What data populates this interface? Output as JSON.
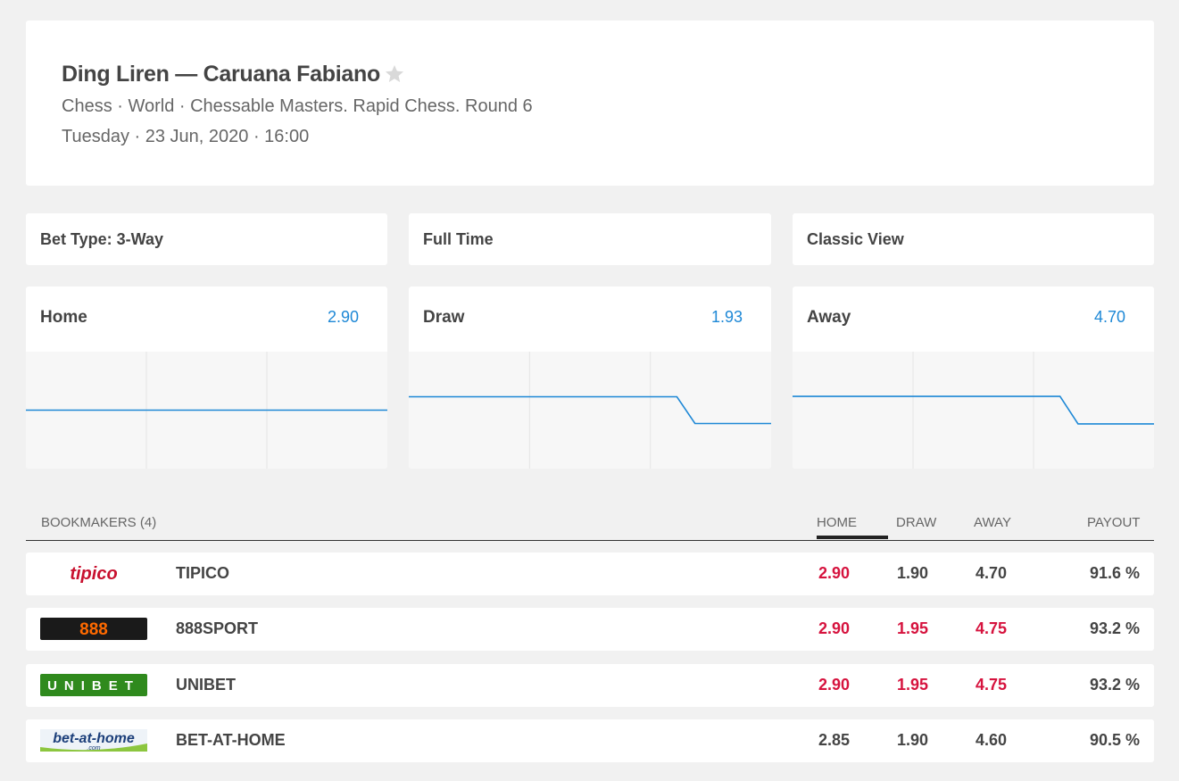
{
  "match": {
    "title": "Ding Liren — Caruana Fabiano",
    "subtitle": "Chess · World · Chessable Masters. Rapid Chess. Round 6",
    "datetime": "Tuesday · 23 Jun, 2020 · 16:00"
  },
  "filters": {
    "bet_type": "Bet Type: 3-Way",
    "period": "Full Time",
    "view": "Classic View"
  },
  "odds_summary": [
    {
      "label": "Home",
      "value": "2.90"
    },
    {
      "label": "Draw",
      "value": "1.93"
    },
    {
      "label": "Away",
      "value": "4.70"
    }
  ],
  "chart_data": [
    {
      "type": "line",
      "series": [
        {
          "values": [
            2.9,
            2.9,
            2.9,
            2.9,
            2.9
          ]
        }
      ]
    },
    {
      "type": "line",
      "series": [
        {
          "values": [
            1.95,
            1.95,
            1.95,
            1.95,
            1.93
          ]
        }
      ]
    },
    {
      "type": "line",
      "series": [
        {
          "values": [
            4.75,
            4.75,
            4.75,
            4.75,
            4.7
          ]
        }
      ]
    }
  ],
  "table": {
    "header": {
      "bookmakers": "BOOKMAKERS (4)",
      "home": "HOME",
      "draw": "DRAW",
      "away": "AWAY",
      "payout": "PAYOUT"
    },
    "rows": [
      {
        "logo": "tipico",
        "name": "TIPICO",
        "home": "2.90",
        "draw": "1.90",
        "away": "4.70",
        "payout": "91.6 %",
        "best": [
          true,
          false,
          false
        ]
      },
      {
        "logo": "888",
        "name": "888SPORT",
        "home": "2.90",
        "draw": "1.95",
        "away": "4.75",
        "payout": "93.2 %",
        "best": [
          true,
          true,
          true
        ]
      },
      {
        "logo": "UNIBET",
        "name": "UNIBET",
        "home": "2.90",
        "draw": "1.95",
        "away": "4.75",
        "payout": "93.2 %",
        "best": [
          true,
          true,
          true
        ]
      },
      {
        "logo": "bet-at-home",
        "logo_sub": ".com",
        "name": "BET-AT-HOME",
        "home": "2.85",
        "draw": "1.90",
        "away": "4.60",
        "payout": "90.5 %",
        "best": [
          false,
          false,
          false
        ]
      }
    ]
  },
  "colors": {
    "accent_blue": "#1e88d6",
    "best_odd_red": "#d6133e",
    "tipico_red": "#c8102e",
    "sport888_orange": "#ff6a00",
    "unibet_green": "#2f8a1d",
    "betathome_navy": "#1c3f7a"
  },
  "icons": {
    "favorite": "star-icon"
  }
}
